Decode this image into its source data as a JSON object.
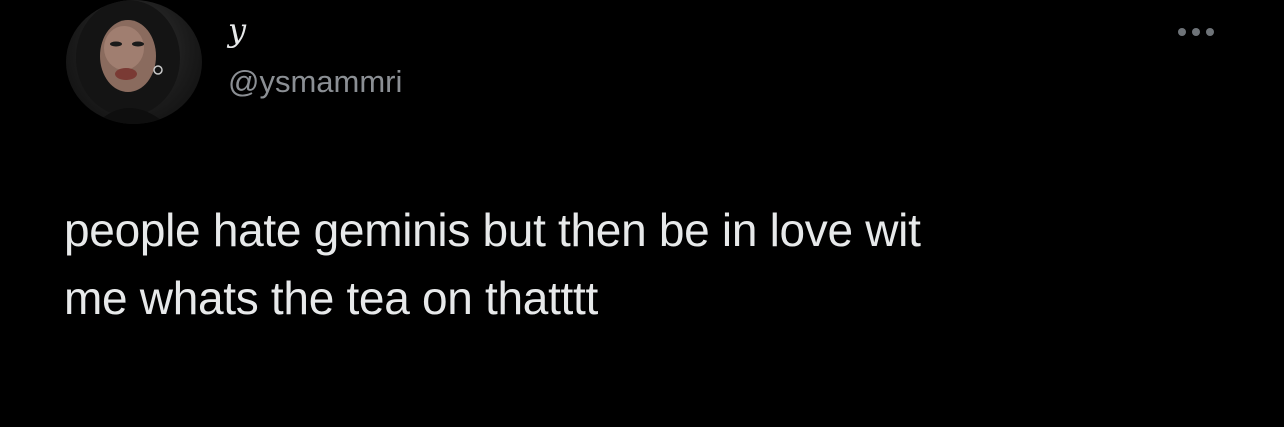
{
  "tweet": {
    "author": {
      "display_name": "y",
      "handle": "@ysmammri",
      "avatar": "profile-photo"
    },
    "more_icon": "more-horizontal-icon",
    "text_lines": [
      "people hate geminis but then be in love wit",
      "me whats the tea on thatttt"
    ]
  },
  "colors": {
    "background": "#000000",
    "primary_text": "#e7e9ea",
    "secondary_text": "#8b8f94"
  }
}
